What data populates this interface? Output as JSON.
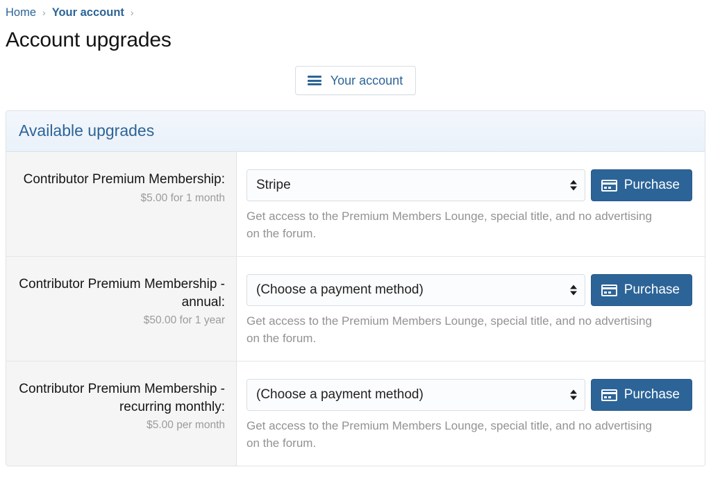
{
  "breadcrumb": {
    "items": [
      {
        "label": "Home",
        "current": false
      },
      {
        "label": "Your account",
        "current": true
      }
    ],
    "separator": "›"
  },
  "page_title": "Account upgrades",
  "account_button": {
    "label": "Your account",
    "icon": "hamburger-menu-icon"
  },
  "panel": {
    "header": "Available upgrades",
    "rows": [
      {
        "title": "Contributor Premium Membership:",
        "price": "$5.00 for 1 month",
        "payment_method": "Stripe",
        "purchase_label": "Purchase",
        "purchase_icon": "credit-card-icon",
        "description": "Get access to the Premium Members Lounge, special title, and no advertising on the forum."
      },
      {
        "title": "Contributor Premium Membership - annual:",
        "price": "$50.00 for 1 year",
        "payment_method": "(Choose a payment method)",
        "purchase_label": "Purchase",
        "purchase_icon": "credit-card-icon",
        "description": "Get access to the Premium Members Lounge, special title, and no advertising on the forum."
      },
      {
        "title": "Contributor Premium Membership - recurring monthly:",
        "price": "$5.00 per month",
        "payment_method": "(Choose a payment method)",
        "purchase_label": "Purchase",
        "purchase_icon": "credit-card-icon",
        "description": "Get access to the Premium Members Lounge, special title, and no advertising on the forum."
      }
    ]
  },
  "colors": {
    "accent": "#2c6498",
    "panel_header_bg": "#eef4fb",
    "label_cell_bg": "#f5f5f5",
    "muted_text": "#929292"
  }
}
